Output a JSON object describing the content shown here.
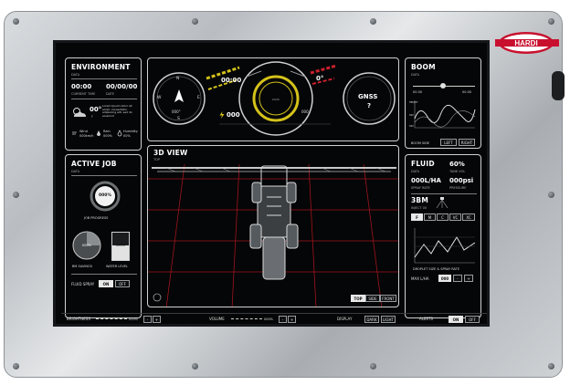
{
  "brand": "HARDI",
  "environment": {
    "title": "ENVIRONMENT",
    "subtitle": "DATA",
    "time_value": "00:00",
    "time_label": "CURRENT TIME",
    "date_value": "00/00/00",
    "date_label": "DATE",
    "temp_value": "00°",
    "temp_sub": "F",
    "weather_text": "Lorem Ipsum dolor sit amet, consectetur adipiscing elit, sed do eiusmod",
    "wind_label": "Wind",
    "wind_value": "000km/h",
    "rain_label": "Rain",
    "rain_value": "000%",
    "humidity_label": "Humidity",
    "humidity_value": "00%"
  },
  "dashboard": {
    "compass_labels": [
      "N",
      "E",
      "S",
      "W"
    ],
    "compass_value": "000°",
    "clock": "00:00",
    "degrees": "0°",
    "speed_value": "000",
    "speed_unit": "km/h",
    "gauge_readout": "000",
    "gnss_label": "GNSS",
    "gnss_value": "?"
  },
  "view3d": {
    "title": "3D VIEW",
    "subtitle": "TOP",
    "tabs": [
      "TOP",
      "SIDE",
      "FRONT"
    ],
    "active_tab": 0
  },
  "active_job": {
    "title": "ACTIVE JOB",
    "subtitle": "DATA",
    "progress_value": "000%",
    "progress_label": "JOB PROGRESS",
    "progress_fraction": 0.0,
    "savings_value": "000%",
    "savings_label": "BM SAVINGS",
    "water_value": "000%",
    "water_label": "WATER LEVEL",
    "fluid_spray_label": "FLUID SPRAY",
    "on_label": "ON",
    "off_label": "OFF"
  },
  "boom": {
    "title": "BOOM",
    "subtitle": "DATA",
    "left_value": "00.00",
    "right_value": "00.00",
    "graph_labels": [
      "HEIGHT",
      "000",
      "000"
    ],
    "side_label": "BOOM SIDE",
    "left_btn": "LEFT",
    "right_btn": "RIGHT"
  },
  "fluid": {
    "title": "FLUID",
    "subtitle": "DATA",
    "tank_value": "60%",
    "tank_label": "TANK VOL",
    "rate_value": "000L/HA",
    "rate_label": "SPRAY RATE",
    "pressure_value": "000psi",
    "pressure_label": "PRESSURE"
  },
  "inject": {
    "title": "3BM",
    "subtitle": "INJECT 00",
    "size_buttons": [
      "F",
      "M",
      "C",
      "VC",
      "XC"
    ],
    "chart_label": "DROPLET SIZE & SPRAY RATE",
    "max_label": "MAX L/HA",
    "max_value": "000",
    "minus": "-",
    "plus": "+"
  },
  "bottom_bar": {
    "brightness_label": "BRIGHTNESS",
    "brightness_value": "000%",
    "volume_label": "VOLUME",
    "volume_value": "000%",
    "display_label": "DISPLAY",
    "dark_label": "DARK",
    "light_label": "LIGHT",
    "alerts_label": "ALERTS",
    "on_label": "ON",
    "off_label": "OFF",
    "minus": "-",
    "plus": "+"
  }
}
